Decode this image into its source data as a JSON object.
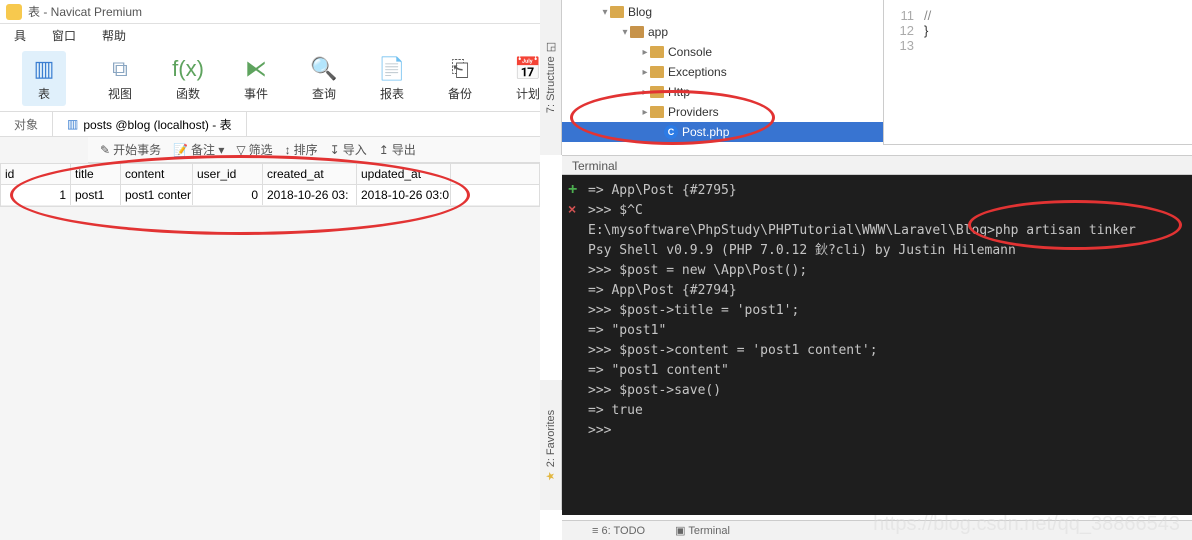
{
  "navicat": {
    "title": "表 - Navicat Premium",
    "menu": [
      "具",
      "窗口",
      "帮助"
    ],
    "ribbon": [
      {
        "label": "表",
        "icon": "▥",
        "active": true,
        "color": "#3a7ed1"
      },
      {
        "label": "视图",
        "icon": "⧉",
        "color": "#8aa6c2"
      },
      {
        "label": "函数",
        "icon": "f(x)",
        "color": "#5ea35e"
      },
      {
        "label": "事件",
        "icon": "⧔",
        "color": "#5ea35e"
      },
      {
        "label": "查询",
        "icon": "🔍",
        "color": "#5b5b5b"
      },
      {
        "label": "报表",
        "icon": "📄",
        "color": "#5b5b5b"
      },
      {
        "label": "备份",
        "icon": "⎗",
        "color": "#5b5b5b"
      },
      {
        "label": "计划",
        "icon": "📅",
        "color": "#c25e5e"
      }
    ],
    "tabs": [
      {
        "label": "对象",
        "active": false
      },
      {
        "label": "posts @blog (localhost) - 表",
        "active": true
      }
    ],
    "toolbar": [
      {
        "icon": "✎",
        "label": "开始事务"
      },
      {
        "icon": "📝",
        "label": "备注 ▾"
      },
      {
        "icon": "▽",
        "label": "筛选"
      },
      {
        "icon": "↕",
        "label": "排序"
      },
      {
        "icon": "↧",
        "label": "导入"
      },
      {
        "icon": "↥",
        "label": "导出"
      }
    ],
    "grid": {
      "columns": [
        "id",
        "title",
        "content",
        "user_id",
        "created_at",
        "updated_at"
      ],
      "rows": [
        {
          "id": "1",
          "title": "post1",
          "content": "post1 conter",
          "user_id": "0",
          "created_at": "2018-10-26 03:",
          "updated_at": "2018-10-26 03:0"
        }
      ]
    }
  },
  "ide": {
    "structure_label": "7: Structure",
    "favorites_label": "2: Favorites",
    "tree": [
      {
        "indent": 38,
        "chev": "▾",
        "icon": "fold",
        "label": "Blog"
      },
      {
        "indent": 58,
        "chev": "▾",
        "icon": "fold open",
        "label": "app"
      },
      {
        "indent": 78,
        "chev": "▸",
        "icon": "fold",
        "label": "Console"
      },
      {
        "indent": 78,
        "chev": "▸",
        "icon": "fold",
        "label": "Exceptions"
      },
      {
        "indent": 78,
        "chev": "▸",
        "icon": "fold",
        "label": "Http"
      },
      {
        "indent": 78,
        "chev": "▸",
        "icon": "fold",
        "label": "Providers"
      },
      {
        "indent": 92,
        "chev": "",
        "icon": "cfile",
        "label": "Post.php",
        "sel": true
      }
    ],
    "editor_lines": [
      {
        "num": "11",
        "text": "        //"
      },
      {
        "num": "12",
        "text": "    }"
      },
      {
        "num": "13",
        "text": ""
      }
    ],
    "terminal_title": "Terminal",
    "terminal_lines": [
      "=> App\\Post {#2795}",
      ">>> $^C",
      "E:\\mysoftware\\PhpStudy\\PHPTutorial\\WWW\\Laravel\\Blog>php artisan tinker",
      "Psy Shell v0.9.9 (PHP 7.0.12 鈥?cli) by Justin Hilemann",
      ">>> $post = new \\App\\Post();",
      "=> App\\Post {#2794}",
      ">>> $post->title = 'post1';",
      "=> \"post1\"",
      ">>> $post->content = 'post1 content';",
      "=> \"post1 content\"",
      ">>> $post->save()",
      "=> true",
      ">>>"
    ],
    "bottom_tabs": [
      "≡ 6: TODO",
      "▣ Terminal"
    ]
  },
  "watermark": "https://blog.csdn.net/qq_38866543"
}
